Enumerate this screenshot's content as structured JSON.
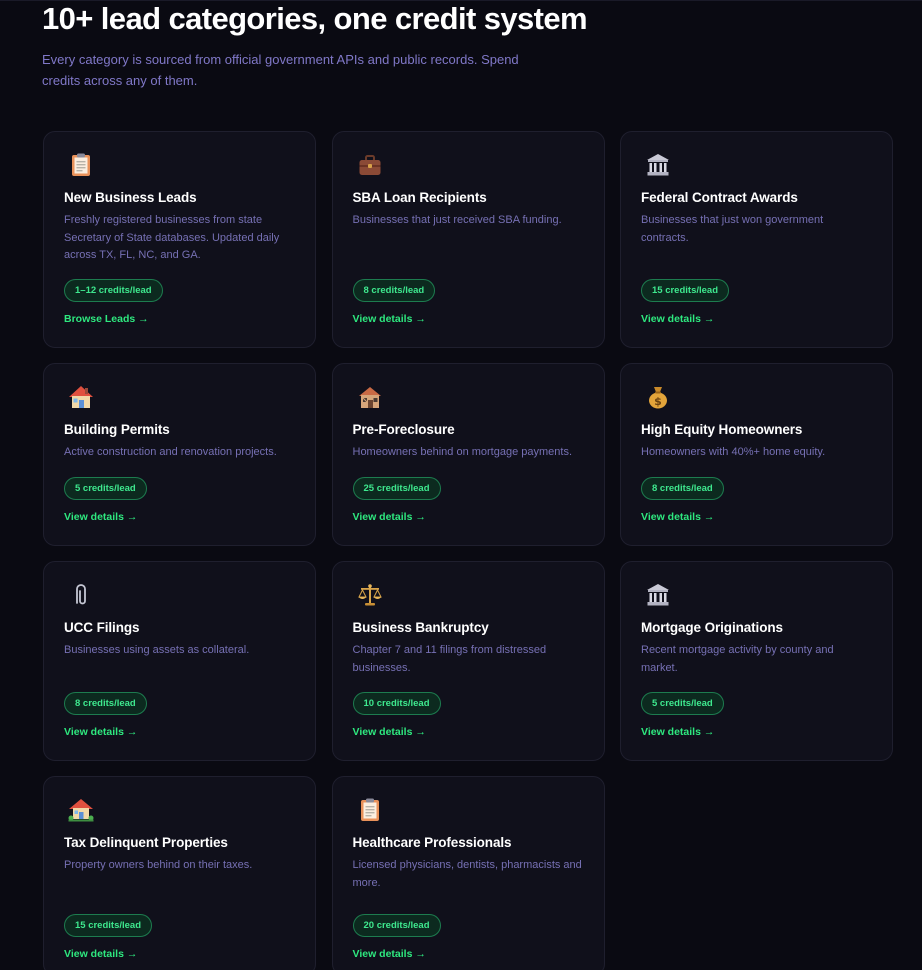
{
  "section": {
    "title": "10+ lead categories, one credit system",
    "subtitle": "Every category is sourced from official government APIs and public records. Spend credits across any of them."
  },
  "categories": [
    {
      "icon": "clipboard-icon",
      "title": "New Business Leads",
      "description": "Freshly registered businesses from state Secretary of State databases. Updated daily across TX, FL, NC, and GA.",
      "credits": "1–12 credits/lead",
      "link": "Browse Leads →"
    },
    {
      "icon": "briefcase-icon",
      "title": "SBA Loan Recipients",
      "description": "Businesses that just received SBA funding.",
      "credits": "8 credits/lead",
      "link": "View details →"
    },
    {
      "icon": "bank-icon",
      "title": "Federal Contract Awards",
      "description": "Businesses that just won government contracts.",
      "credits": "15 credits/lead",
      "link": "View details →"
    },
    {
      "icon": "house-icon",
      "title": "Building Permits",
      "description": "Active construction and renovation projects.",
      "credits": "5 credits/lead",
      "link": "View details →"
    },
    {
      "icon": "derelict-house-icon",
      "title": "Pre-Foreclosure",
      "description": "Homeowners behind on mortgage payments.",
      "credits": "25 credits/lead",
      "link": "View details →"
    },
    {
      "icon": "money-bag-icon",
      "title": "High Equity Homeowners",
      "description": "Homeowners with 40%+ home equity.",
      "credits": "8 credits/lead",
      "link": "View details →"
    },
    {
      "icon": "paperclip-icon",
      "title": "UCC Filings",
      "description": "Businesses using assets as collateral.",
      "credits": "8 credits/lead",
      "link": "View details →"
    },
    {
      "icon": "scales-icon",
      "title": "Business Bankruptcy",
      "description": "Chapter 7 and 11 filings from distressed businesses.",
      "credits": "10 credits/lead",
      "link": "View details →"
    },
    {
      "icon": "bank-icon",
      "title": "Mortgage Originations",
      "description": "Recent mortgage activity by county and market.",
      "credits": "5 credits/lead",
      "link": "View details →"
    },
    {
      "icon": "house-garden-icon",
      "title": "Tax Delinquent Properties",
      "description": "Property owners behind on their taxes.",
      "credits": "15 credits/lead",
      "link": "View details →"
    },
    {
      "icon": "clipboard-icon",
      "title": "Healthcare Professionals",
      "description": "Licensed physicians, dentists, pharmacists and more.",
      "credits": "20 credits/lead",
      "link": "View details →"
    }
  ],
  "colors": {
    "background": "#0a0a12",
    "card": "#10101b",
    "accent_green": "#2ee87f",
    "muted_text": "#7670b4"
  }
}
